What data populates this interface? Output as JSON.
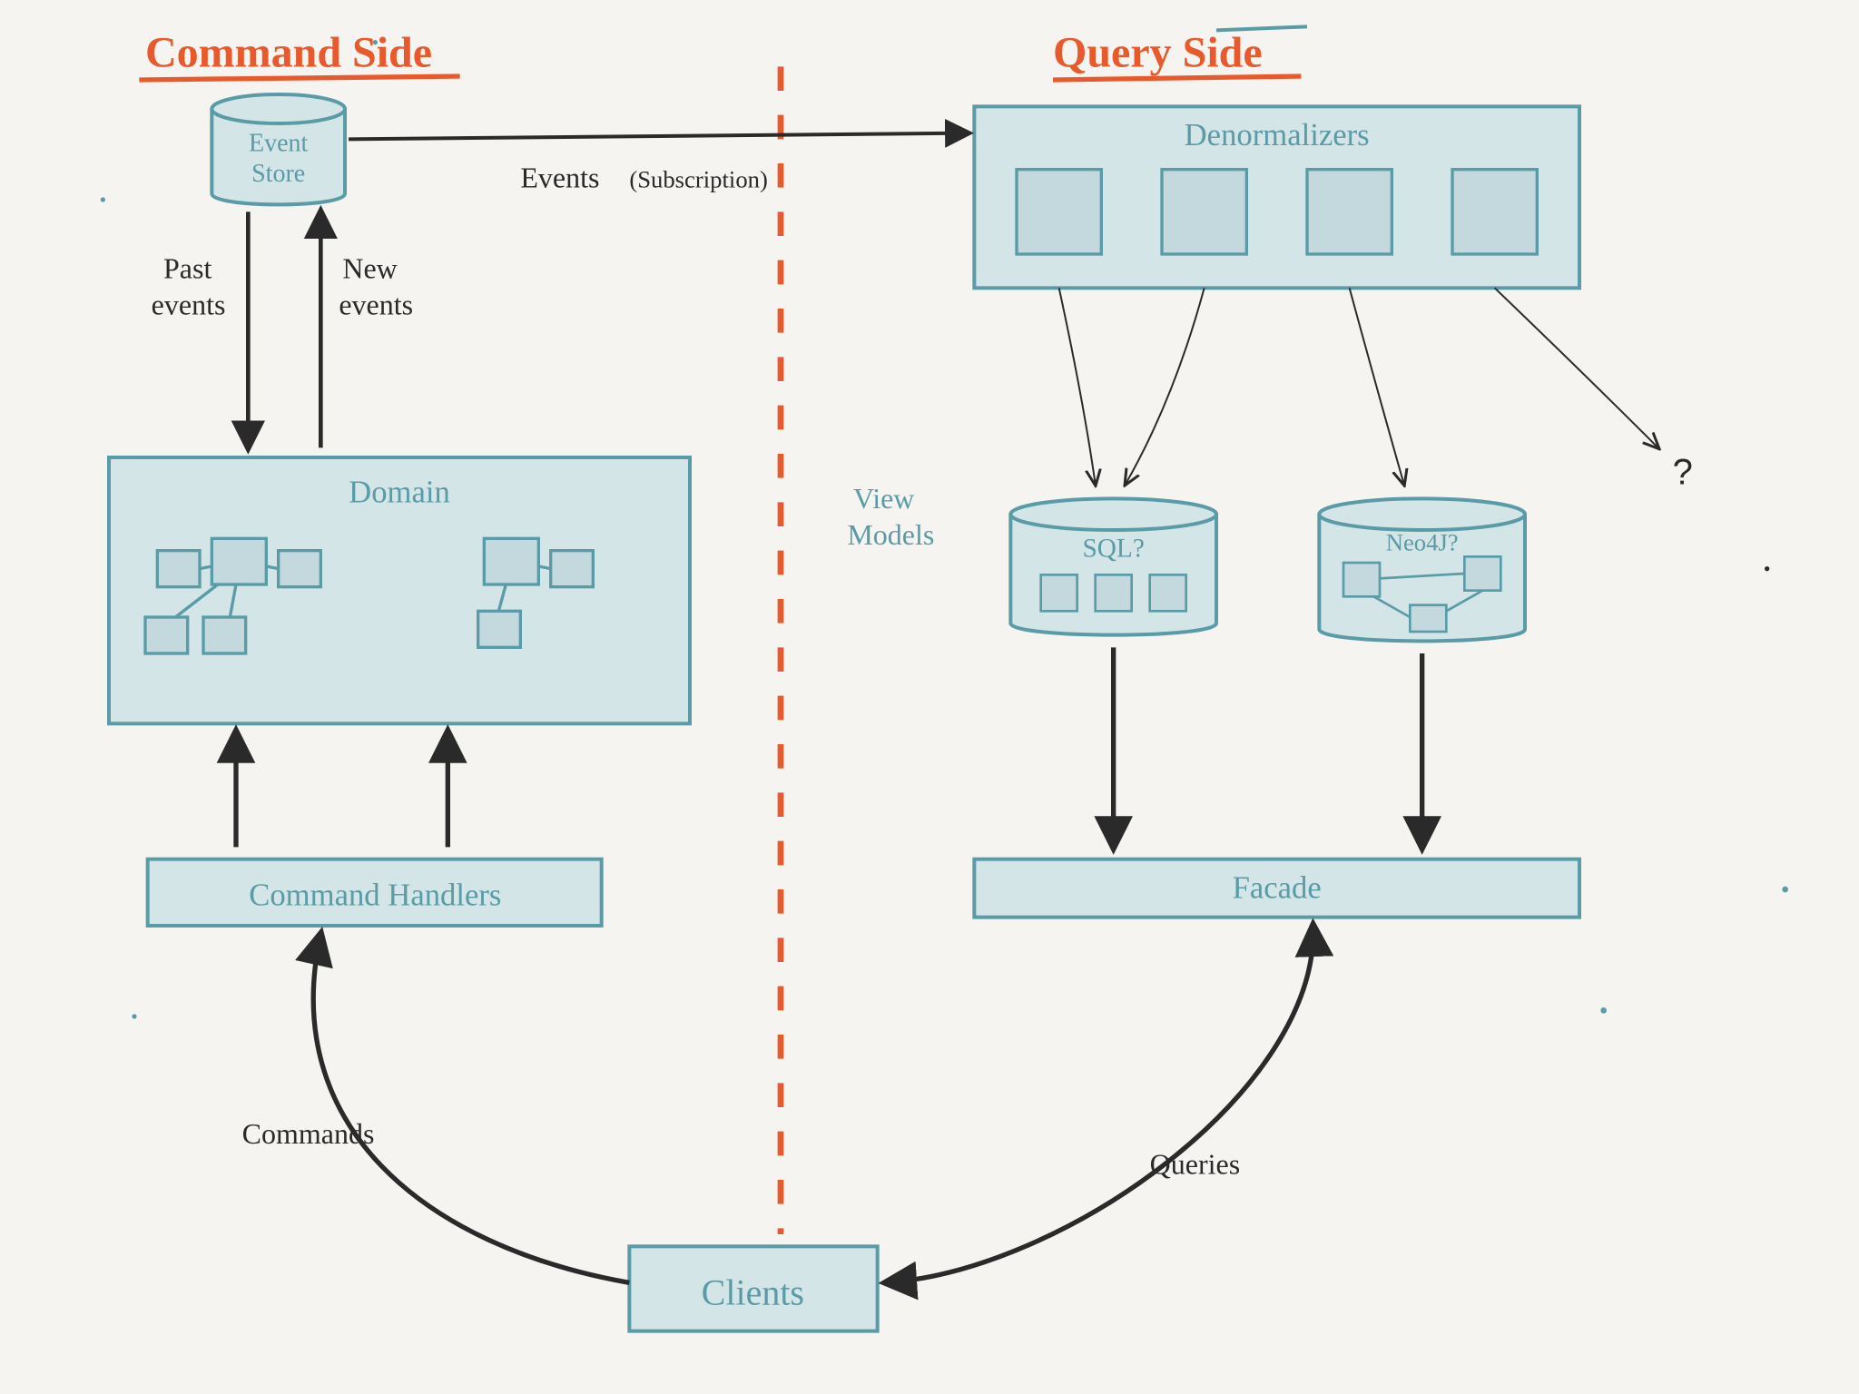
{
  "titles": {
    "command": "Command Side",
    "query": "Query Side"
  },
  "boxes": {
    "event_store_l1": "Event",
    "event_store_l2": "Store",
    "denormalizers": "Denormalizers",
    "domain": "Domain",
    "sql": "SQL?",
    "neo4j": "Neo4J?",
    "command_handlers": "Command Handlers",
    "facade": "Facade",
    "clients": "Clients"
  },
  "labels": {
    "events": "Events",
    "subscription": "(Subscription)",
    "past_events_l1": "Past",
    "past_events_l2": "events",
    "new_events_l1": "New",
    "new_events_l2": "events",
    "view_models_l1": "View",
    "view_models_l2": "Models",
    "commands": "Commands",
    "queries": "Queries",
    "qmark": "?"
  },
  "colors": {
    "title": "#e85a2c",
    "box_stroke": "#5a9ba8",
    "box_fill": "#d4e5e8",
    "arrow": "#2a2a2a",
    "divider": "#e85a2c",
    "bg": "#f5f4f0"
  }
}
